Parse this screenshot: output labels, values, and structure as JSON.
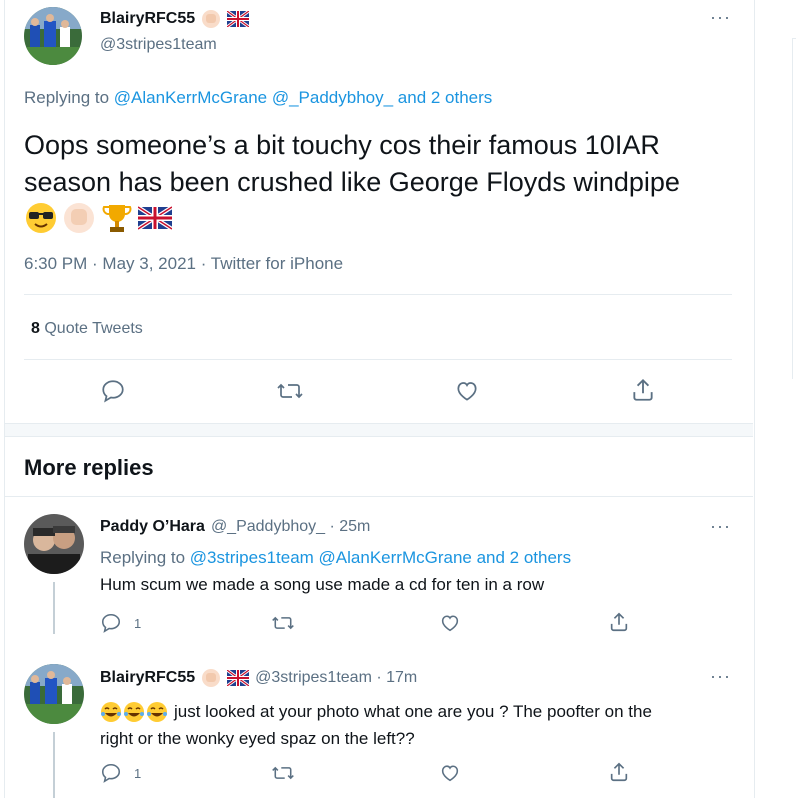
{
  "main_tweet": {
    "name": "BlairyRFC55",
    "handle": "@3stripes1team",
    "replying_prefix": "Replying to",
    "replying_to": "@AlanKerrMcGrane @_Paddybhoy_ and 2 others",
    "text_line1": "Oops someone’s a bit touchy cos their famous 10IAR",
    "text_line2": "season has been crushed like George Floyds windpipe",
    "timestamp": "6:30 PM · May 3, 2021 · Twitter for iPhone",
    "quote_count": "8",
    "quote_label": "Quote Tweets"
  },
  "section": {
    "title": "More replies"
  },
  "replies": [
    {
      "name": "Paddy O’Hara",
      "handle": "@_Paddybhoy_ · 25m",
      "replying_prefix": "Replying to",
      "replying_to": "@3stripes1team @AlanKerrMcGrane and 2 others",
      "text": "Hum scum we made a song use made a cd for ten in a row",
      "reply_count": "1"
    },
    {
      "name": "BlairyRFC55",
      "handle": "@3stripes1team · 17m",
      "text_line1": "just looked at your photo what one are you ? The poofter on the",
      "text_line2": "right or the wonky eyed spaz on the left??",
      "reply_count": "1"
    }
  ],
  "colors": {
    "link": "#1b95e0",
    "muted": "#5b7083",
    "border": "#e6ecf0"
  },
  "icons": [
    "more-icon",
    "reply-icon",
    "retweet-icon",
    "like-icon",
    "share-icon",
    "sunglasses-emoji",
    "raised-fist-emoji",
    "trophy-emoji",
    "uk-flag-emoji",
    "tears-of-joy-emoji"
  ]
}
